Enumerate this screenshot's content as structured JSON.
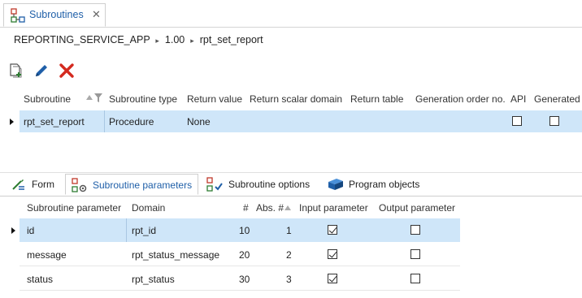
{
  "tab": {
    "title": "Subroutines",
    "close": "✕"
  },
  "breadcrumb": {
    "app": "REPORTING_SERVICE_APP",
    "sep1": "▸",
    "version": "1.00",
    "sep2": "▸",
    "item": "rpt_set_report"
  },
  "toolbar": {
    "add_icon": "add-document-icon",
    "edit_icon": "pencil-icon",
    "delete_icon": "red-x-icon"
  },
  "main_grid": {
    "columns": [
      "Subroutine",
      "Subroutine type",
      "Return value",
      "Return scalar domain",
      "Return table",
      "Generation order no.",
      "API",
      "Generated"
    ],
    "rows": [
      {
        "subroutine": "rpt_set_report",
        "type": "Procedure",
        "return_value": "None",
        "api": false,
        "generated": false
      }
    ]
  },
  "bottom_tabs": [
    {
      "label": "Form",
      "icon": "form-icon"
    },
    {
      "label": "Subroutine parameters",
      "icon": "parameters-icon"
    },
    {
      "label": "Subroutine options",
      "icon": "options-icon"
    },
    {
      "label": "Program objects",
      "icon": "cube-icon"
    }
  ],
  "active_tab": "Subroutine parameters",
  "param_grid": {
    "columns": [
      "Subroutine parameter",
      "Domain",
      "#",
      "Abs. #",
      "Input parameter",
      "Output parameter"
    ],
    "rows": [
      {
        "name": "id",
        "domain": "rpt_id",
        "order": "10",
        "abs": "1",
        "input": true,
        "output": false
      },
      {
        "name": "message",
        "domain": "rpt_status_message",
        "order": "20",
        "abs": "2",
        "input": true,
        "output": false
      },
      {
        "name": "status",
        "domain": "rpt_status",
        "order": "30",
        "abs": "3",
        "input": true,
        "output": false
      }
    ]
  },
  "colors": {
    "selection": "#cfe6f9",
    "accent": "#1f5fa8",
    "delete": "#d42a1f"
  }
}
